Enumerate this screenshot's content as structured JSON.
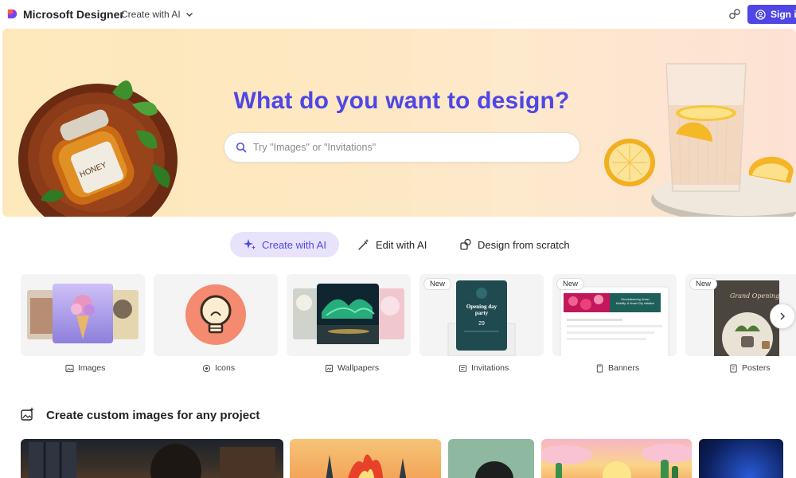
{
  "header": {
    "brand": "Microsoft Designer",
    "create_menu_label": "Create with AI",
    "signin_label": "Sign in"
  },
  "hero": {
    "title": "What do you want to design?",
    "search_placeholder": "Try \"Images\" or \"Invitations\"",
    "honey_label": "HONEY"
  },
  "tabs": [
    {
      "label": "Create with AI",
      "active": true,
      "icon": "sparkle-icon"
    },
    {
      "label": "Edit with AI",
      "active": false,
      "icon": "magic-wand-icon"
    },
    {
      "label": "Design from scratch",
      "active": false,
      "icon": "shapes-icon"
    }
  ],
  "categories": [
    {
      "label": "Images",
      "icon": "image-icon",
      "badge": ""
    },
    {
      "label": "Icons",
      "icon": "icons-icon",
      "badge": ""
    },
    {
      "label": "Wallpapers",
      "icon": "wallpaper-icon",
      "badge": ""
    },
    {
      "label": "Invitations",
      "icon": "invitation-icon",
      "badge": "New"
    },
    {
      "label": "Banners",
      "icon": "banner-icon",
      "badge": "New"
    },
    {
      "label": "Posters",
      "icon": "poster-icon",
      "badge": "New"
    }
  ],
  "thumb_text": {
    "invitation_title": "Opening day party",
    "invitation_date": "29",
    "banner_text": "Revolutionizing Urban Mobility: A Smart City Initiative",
    "poster_text": "Grand Opening"
  },
  "section": {
    "title": "Create custom images for any project"
  },
  "colors": {
    "accent": "#4f46e5",
    "active_tab_bg": "#e8e3fb",
    "hero_bg": "#fde9bc"
  }
}
